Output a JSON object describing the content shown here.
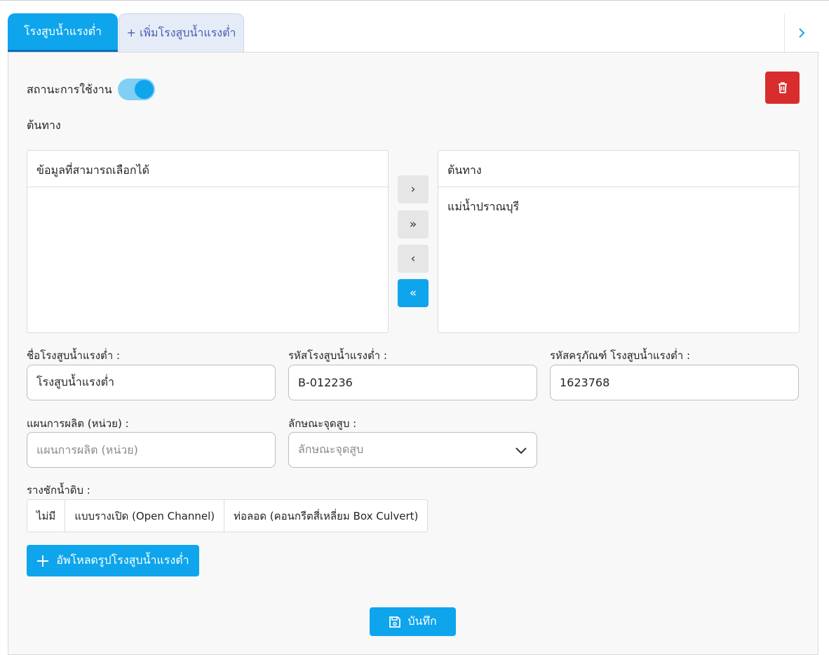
{
  "tabs": {
    "active_label": "โรงสูบน้ำแรงต่ำ",
    "add_label": "+ เพิ่มโรงสูบน้ำแรงต่ำ"
  },
  "status": {
    "label": "สถานะการใช้งาน",
    "enabled": true
  },
  "source_section": {
    "label": "ต้นทาง",
    "available": {
      "header": "ข้อมูลที่สามารถเลือกได้",
      "items": []
    },
    "selected": {
      "header": "ต้นทาง",
      "items": [
        "แม่น้ำปราณบุรี"
      ]
    },
    "buttons": {
      "move_right": "›",
      "move_all_right": "»",
      "move_left": "‹",
      "move_all_left": "«"
    }
  },
  "form": {
    "station_name": {
      "label": "ชื่อโรงสูบน้ำแรงต่ำ :",
      "value": "โรงสูบน้ำแรงต่ำ"
    },
    "station_code": {
      "label": "รหัสโรงสูบน้ำแรงต่ำ :",
      "value": "B-012236"
    },
    "asset_code": {
      "label": "รหัสครุภัณฑ์ โรงสูบน้ำแรงต่ำ :",
      "value": "1623768"
    },
    "production_plan": {
      "label": "แผนการผลิต (หน่วย) :",
      "placeholder": "แผนการผลิต (หน่วย)",
      "value": ""
    },
    "intake_type": {
      "label": "ลักษณะจุดสูบ :",
      "placeholder": "ลักษณะจุดสูบ"
    },
    "sediment_channel": {
      "label": "รางชักน้ำดิบ :",
      "options": [
        "ไม่มี",
        "แบบรางเปิด (Open Channel)",
        "ท่อลอด (คอนกรีตสี่เหลี่ยม Box Culvert)"
      ]
    }
  },
  "actions": {
    "upload_label": "อัพโหลดรูปโรงสูบน้ำแรงต่ำ",
    "save_label": "บันทึก"
  },
  "colors": {
    "primary": "#0ea5ec",
    "danger": "#d92d2d"
  }
}
